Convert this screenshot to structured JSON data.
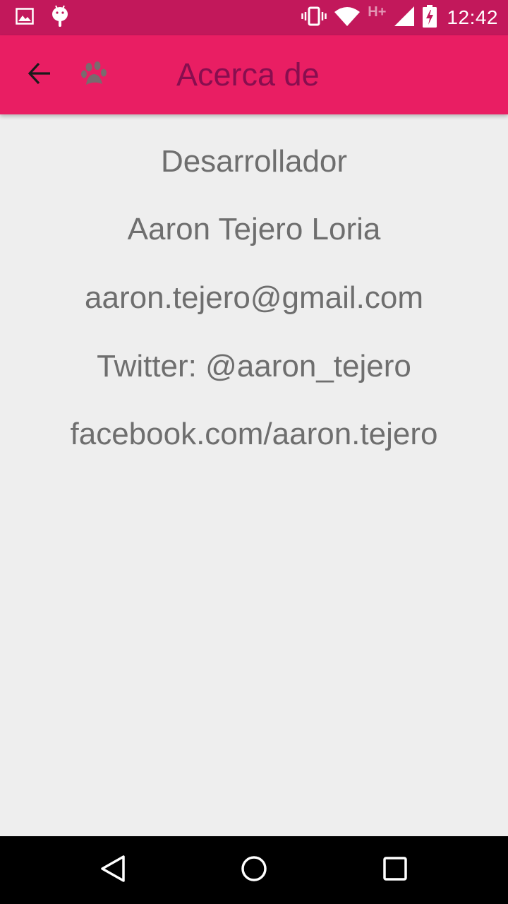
{
  "status_bar": {
    "time": "12:42",
    "network_label": "H+",
    "icons": [
      "image-icon",
      "android-debug-icon",
      "vibrate-icon",
      "wifi-icon",
      "signal-icon",
      "battery-charging-icon"
    ],
    "background_color": "#C2185B"
  },
  "app_bar": {
    "title": "Acerca de",
    "back_icon": "arrow-back-icon",
    "logo_icon": "paw-icon",
    "background_color": "#E91E63",
    "title_color": "#880E4F"
  },
  "content": {
    "lines": [
      "Desarrollador",
      "Aaron Tejero Loria",
      "aaron.tejero@gmail.com",
      "Twitter: @aaron_tejero",
      "facebook.com/aaron.tejero"
    ],
    "text_color": "#6E6E6E",
    "background_color": "#EEEEEE"
  },
  "nav_bar": {
    "buttons": [
      "back-triangle-icon",
      "home-circle-icon",
      "recents-square-icon"
    ]
  }
}
